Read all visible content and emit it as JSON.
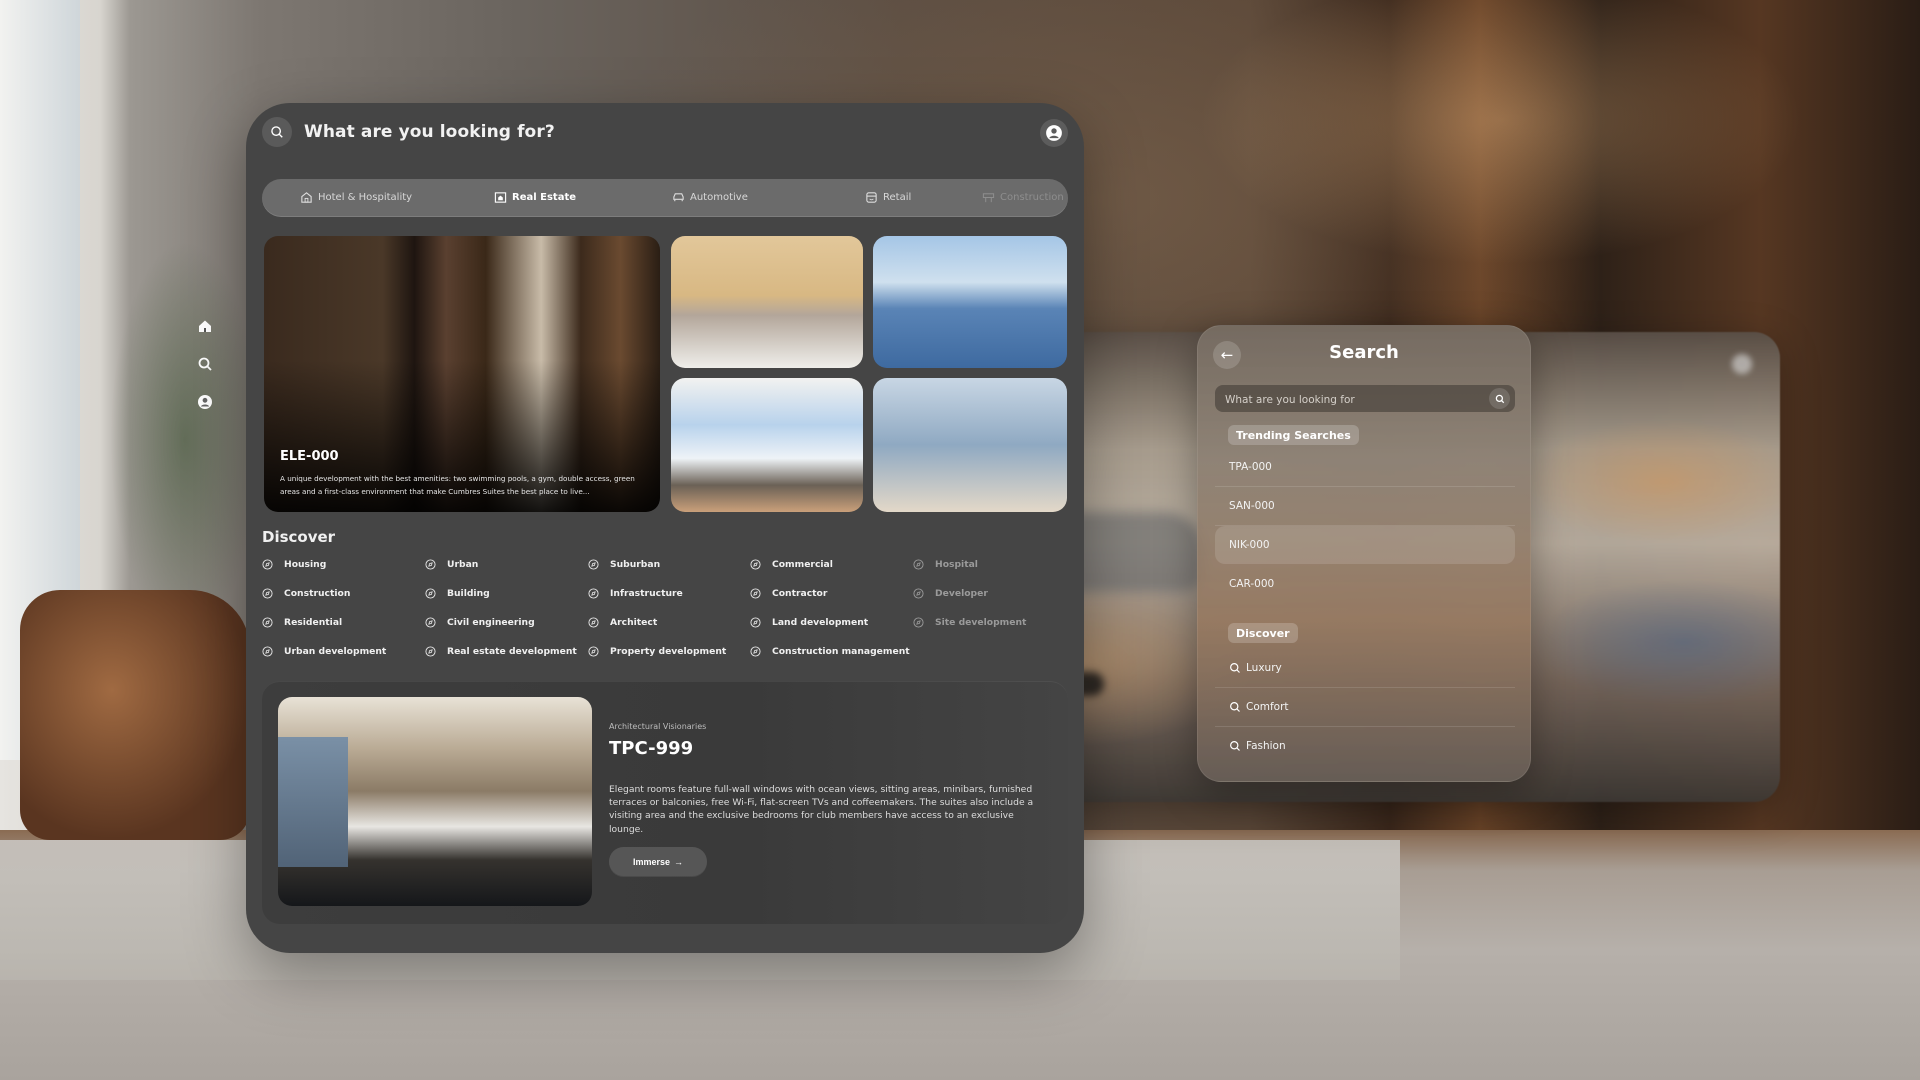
{
  "main": {
    "search_title": "What are you looking for?",
    "side_nav": [
      {
        "icon": "home-icon"
      },
      {
        "icon": "search-icon"
      },
      {
        "icon": "user-icon"
      }
    ],
    "tabs": [
      {
        "label": "Hotel & Hospitality",
        "icon": "hotel-icon",
        "state": "normal"
      },
      {
        "label": "Real Estate",
        "icon": "real-estate-icon",
        "state": "active"
      },
      {
        "label": "Automotive",
        "icon": "car-icon",
        "state": "normal"
      },
      {
        "label": "Retail",
        "icon": "store-icon",
        "state": "normal"
      },
      {
        "label": "Construction",
        "icon": "barrier-icon",
        "state": "faded"
      }
    ],
    "hero": {
      "title": "ELE-000",
      "description": "A unique development with the best amenities: two swimming pools, a gym, double access, green areas and a first-class environment that make Cumbres Suites the best place to live..."
    },
    "discover": {
      "title": "Discover",
      "columns": [
        [
          "Housing",
          "Construction",
          "Residential",
          "Urban development"
        ],
        [
          "Urban",
          "Building",
          "Civil engineering",
          "Real estate development"
        ],
        [
          "Suburban",
          "Infrastructure",
          "Architect",
          "Property development"
        ],
        [
          "Commercial",
          "Contractor",
          "Land development",
          "Construction management"
        ],
        [
          "Hospital",
          "Developer",
          "Site development"
        ]
      ]
    },
    "feature_card": {
      "eyebrow": "Architectural Visionaries",
      "title": "TPC-999",
      "description": "Elegant rooms feature full-wall windows with ocean views, sitting areas, minibars, furnished terraces or balconies, free Wi-Fi, flat-screen TVs and coffeemakers. The suites also include a visiting area and the exclusive bedrooms for club members have access to an exclusive lounge.",
      "button_label": "Immerse",
      "button_arrow": "→"
    }
  },
  "search_panel": {
    "title": "Search",
    "back_arrow": "←",
    "input_placeholder": "What are you looking for",
    "input_value": "",
    "trending_label": "Trending Searches",
    "trending": [
      "TPA-000",
      "SAN-000",
      "NIK-000",
      "CAR-000"
    ],
    "highlighted_trending_index": 2,
    "discover_label": "Discover",
    "discover_items": [
      "Luxury",
      "Comfort",
      "Fashion"
    ]
  },
  "colors": {
    "panel_bg": "#454545",
    "tabbar_bg": "#6b6b6b",
    "card_bg": "#3d3d3d",
    "button_bg": "#565656",
    "text_primary": "#ffffff"
  }
}
